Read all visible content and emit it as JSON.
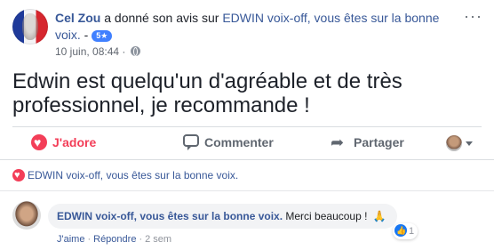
{
  "header": {
    "author": "Cel Zou",
    "action_text": " a donné son avis sur ",
    "page_name": "EDWIN voix-off, vous êtes sur la bonne voix.",
    "separator": " - ",
    "rating_badge": "5★",
    "timestamp": "10 juin, 08:44 · ",
    "more": "···"
  },
  "post": {
    "text": "Edwin est quelqu'un d'agréable et de très professionnel, je recommande !"
  },
  "actions": {
    "love_label": "J'adore",
    "comment_label": "Commenter",
    "share_label": "Partager"
  },
  "reactors": {
    "page_name": "EDWIN voix-off, vous êtes sur la bonne voix."
  },
  "reply": {
    "author": "EDWIN voix-off, vous êtes sur la bonne voix.",
    "text": " Merci beaucoup ! ",
    "pray": "🙏",
    "like_label": "J'aime",
    "reply_label": "Répondre",
    "dot": "·",
    "time": "2 sem",
    "like_count": "1"
  },
  "colors": {
    "link": "#385898",
    "love": "#f33e58",
    "like": "#1877f2",
    "badge": "#4080ff"
  },
  "icons": [
    "france-flag-avatar",
    "globe-icon",
    "more-icon",
    "heart-icon",
    "comment-icon",
    "share-icon",
    "caret-icon",
    "like-icon",
    "pray-icon"
  ]
}
